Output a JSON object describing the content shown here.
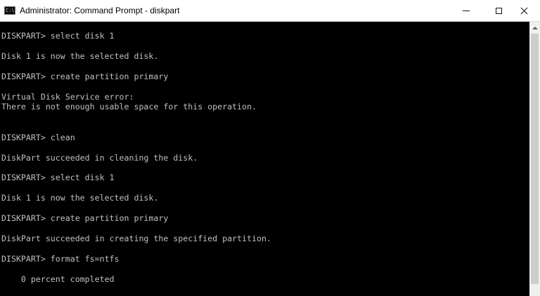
{
  "window": {
    "title": "Administrator: Command Prompt - diskpart",
    "icon_text": "C:\\."
  },
  "console": {
    "lines": [
      "DISKPART> select disk 1",
      "",
      "Disk 1 is now the selected disk.",
      "",
      "DISKPART> create partition primary",
      "",
      "Virtual Disk Service error:",
      "There is not enough usable space for this operation.",
      "",
      "",
      "DISKPART> clean",
      "",
      "DiskPart succeeded in cleaning the disk.",
      "",
      "DISKPART> select disk 1",
      "",
      "Disk 1 is now the selected disk.",
      "",
      "DISKPART> create partition primary",
      "",
      "DiskPart succeeded in creating the specified partition.",
      "",
      "DISKPART> format fs=ntfs",
      "",
      "    0 percent completed"
    ]
  },
  "icons": {
    "app": "command-prompt-icon",
    "minimize": "minimize-icon",
    "maximize": "maximize-icon",
    "close": "close-icon",
    "scroll_up": "scroll-up-arrow-icon"
  }
}
